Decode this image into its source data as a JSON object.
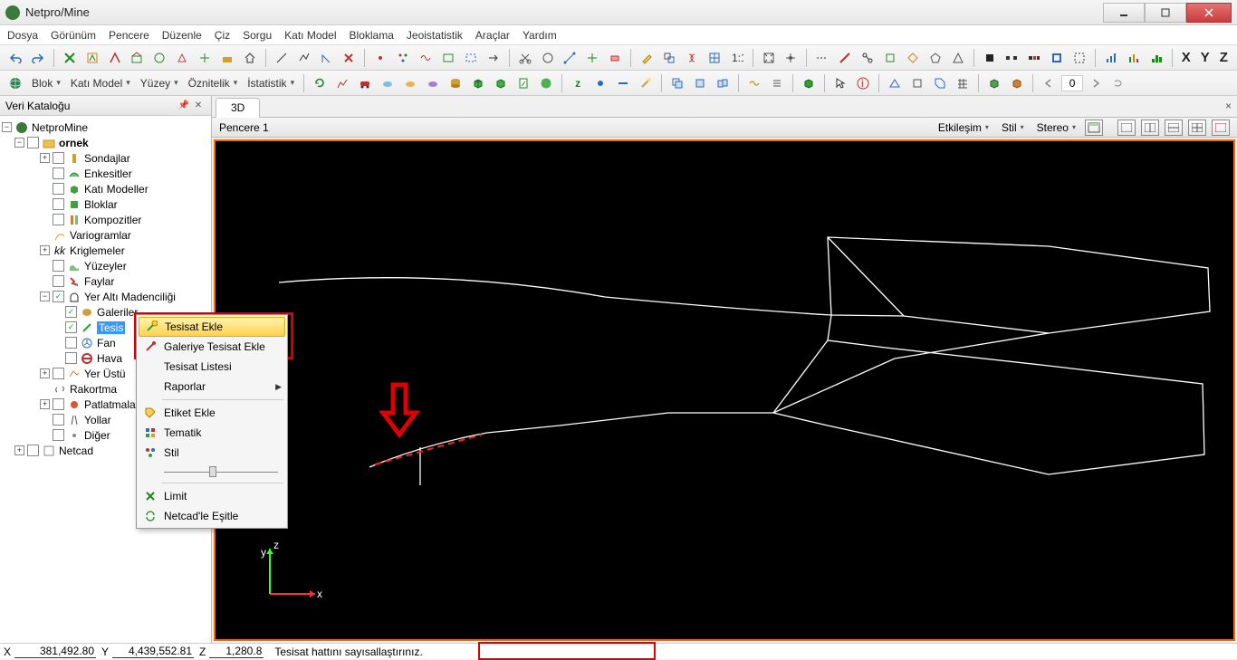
{
  "window": {
    "title": "Netpro/Mine"
  },
  "menu": [
    "Dosya",
    "Görünüm",
    "Pencere",
    "Düzenle",
    "Çiz",
    "Sorgu",
    "Katı Model",
    "Bloklama",
    "Jeoistatistik",
    "Araçlar",
    "Yardım"
  ],
  "toolbar2": {
    "blok": "Blok",
    "kati": "Katı Model",
    "yuzey": "Yüzey",
    "oznitelik": "Öznitelik",
    "istatistik": "İstatistik"
  },
  "sidebar": {
    "title": "Veri Kataloğu",
    "root": "NetproMine",
    "project": "ornek",
    "items": {
      "sondaj": "Sondajlar",
      "enkesit": "Enkesitler",
      "katimodel": "Katı Modeller",
      "blok": "Bloklar",
      "kompozit": "Kompozitler",
      "variogram": "Variogramlar",
      "krigleme": "Kriglemeler",
      "yuzey": "Yüzeyler",
      "fay": "Faylar",
      "yeralti": "Yer Altı Madenciliği",
      "galeri": "Galeriler",
      "tesis": "Tesis",
      "fan": "Fan",
      "hava": "Hava",
      "yerustu": "Yer Üstü",
      "rakortma": "Rakortma",
      "patlatma": "Patlatmala",
      "yollar": "Yollar",
      "diger": "Diğer"
    },
    "netcad": "Netcad"
  },
  "context_menu": {
    "tesisat_ekle": "Tesisat Ekle",
    "galeriye": "Galeriye Tesisat Ekle",
    "listesi": "Tesisat Listesi",
    "raporlar": "Raporlar",
    "etiket": "Etiket Ekle",
    "tematik": "Tematik",
    "stil": "Stil",
    "limit": "Limit",
    "esitle": "Netcad'le Eşitle"
  },
  "tab": {
    "name": "3D"
  },
  "pencere": {
    "title": "Pencere 1",
    "etkile": "Etkileşim",
    "stil": "Stil",
    "stereo": "Stereo"
  },
  "status": {
    "x_lbl": "X",
    "x": "381,492.80",
    "y_lbl": "Y",
    "y": "4,439,552.81",
    "z_lbl": "Z",
    "z": "1,280.8",
    "msg": "Tesisat hattını sayısallaştırınız."
  },
  "xyz_labels": {
    "x": "X",
    "y": "Y",
    "z": "Z"
  },
  "zero": "0"
}
